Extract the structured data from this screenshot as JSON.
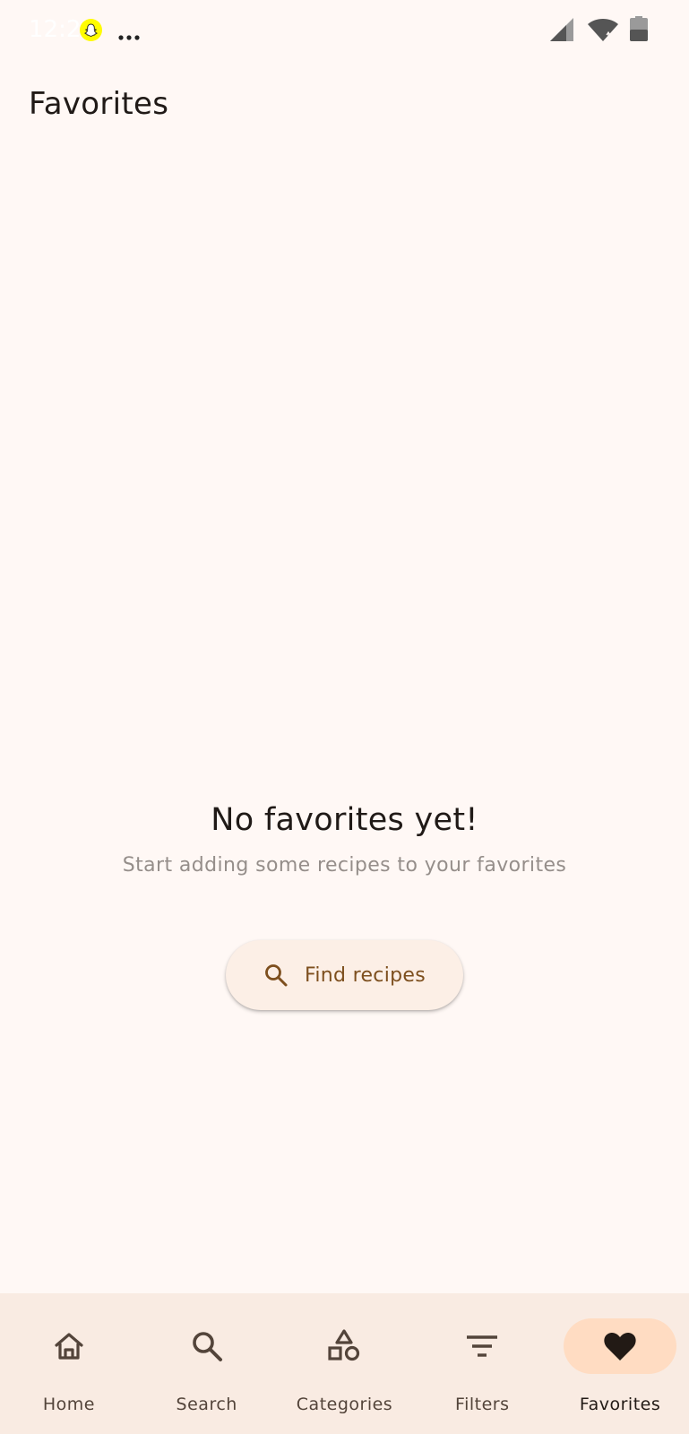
{
  "status_bar": {
    "time": "12:29",
    "icons": [
      "snapchat-icon",
      "more-dots-icon",
      "signal-icon",
      "wifi-icon",
      "battery-icon"
    ]
  },
  "header": {
    "title": "Favorites"
  },
  "empty_state": {
    "title": "No favorites yet!",
    "subtitle": "Start adding some recipes to your favorites",
    "button": {
      "label": "Find recipes",
      "icon": "search-icon"
    }
  },
  "bottom_nav": {
    "items": [
      {
        "label": "Home",
        "icon": "home-icon",
        "active": false
      },
      {
        "label": "Search",
        "icon": "search-icon",
        "active": false
      },
      {
        "label": "Categories",
        "icon": "categories-icon",
        "active": false
      },
      {
        "label": "Filters",
        "icon": "filter-icon",
        "active": false
      },
      {
        "label": "Favorites",
        "icon": "heart-icon",
        "active": true
      }
    ]
  },
  "colors": {
    "background": "#fff8f5",
    "nav_background": "#f9ebe2",
    "active_indicator": "#ffdcc2",
    "button_background": "#fcefe6",
    "button_text": "#7d4f1e",
    "subtitle_text": "#958e8a",
    "primary_text": "#201a17",
    "nav_icon": "#53443a"
  }
}
